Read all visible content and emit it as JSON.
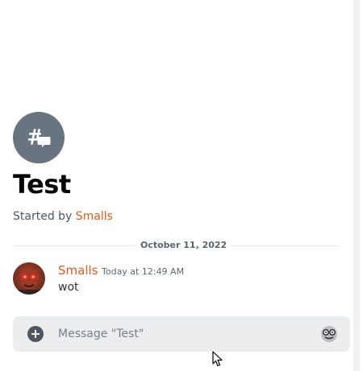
{
  "thread": {
    "title": "Test",
    "started_by_prefix": "Started by ",
    "started_by_user": "Smalls"
  },
  "divider": {
    "date": "October 11, 2022"
  },
  "messages": [
    {
      "author": "Smalls",
      "timestamp": "Today at 12:49 AM",
      "text": "wot"
    }
  ],
  "composer": {
    "placeholder": "Message \"Test\""
  },
  "icons": {
    "thread": "thread-icon",
    "add": "plus-circle-icon",
    "emoji": "emoji-face-icon",
    "cursor": "mouse-pointer-icon"
  },
  "colors": {
    "accent_username": "#dc5a1e",
    "thread_icon_bg": "#6a7480",
    "composer_bg": "#ebedef"
  }
}
